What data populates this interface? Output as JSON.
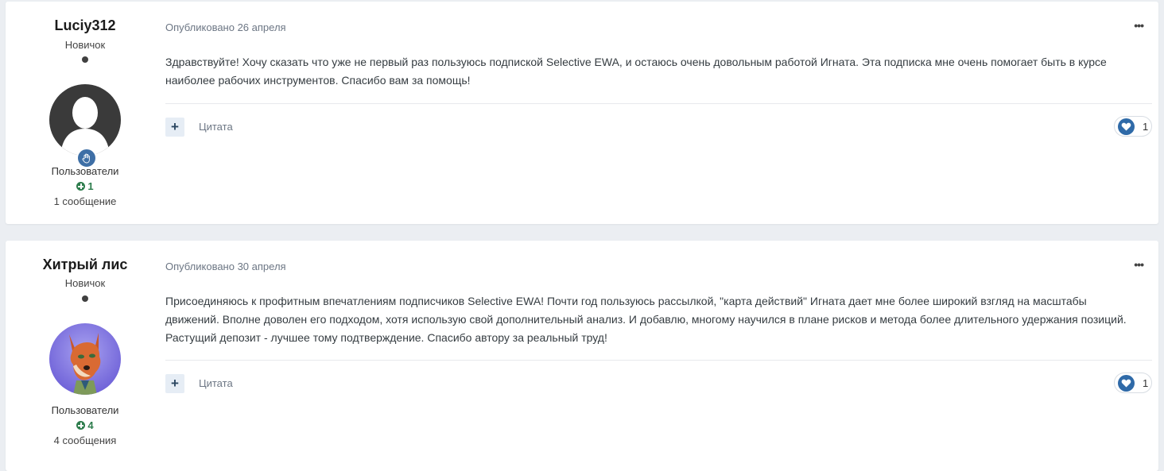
{
  "posts": [
    {
      "author": {
        "name": "Luciy312",
        "rank": "Новичок",
        "group": "Пользователи",
        "reputation": "1",
        "post_count": "1 сообщение"
      },
      "date": "Опубликовано 26 апреля",
      "body": "Здравствуйте! Хочу сказать что уже не первый раз пользуюсь подпиской Selective EWA, и остаюсь очень довольным работой Игната. Эта подписка мне очень помогает быть в курсе наиболее рабочих инструментов. Спасибо вам за помощь!",
      "add_label": "+",
      "quote_label": "Цитата",
      "reaction_count": "1",
      "menu_label": "•••"
    },
    {
      "author": {
        "name": "Хитрый лис",
        "rank": "Новичок",
        "group": "Пользователи",
        "reputation": "4",
        "post_count": "4 сообщения"
      },
      "date": "Опубликовано 30 апреля",
      "body": "Присоединяюсь к профитным впечатлениям подписчиков Selective EWA! Почти год пользуюсь рассылкой,  \"карта действий\" Игната дает мне более широкий взгляд на масштабы движений. Вполне доволен его подходом, хотя использую свой дополнительный анализ. И добавлю, многому научился в плане рисков и метода более длительного удержания позиций. Растущий депозит - лучшее тому подтверждение. Спасибо автору за реальный труд!",
      "add_label": "+",
      "quote_label": "Цитата",
      "reaction_count": "1",
      "menu_label": "•••"
    }
  ],
  "colors": {
    "page_background": "#ebeef2",
    "reputation_green": "#2e7d4d",
    "reaction_heart": "#2f6aa8",
    "role_badge": "#3e6fa6"
  },
  "icons": {
    "role_badge": "hand-icon",
    "reputation": "plus-circle-icon",
    "reaction": "heart-icon",
    "menu": "more-icon"
  }
}
